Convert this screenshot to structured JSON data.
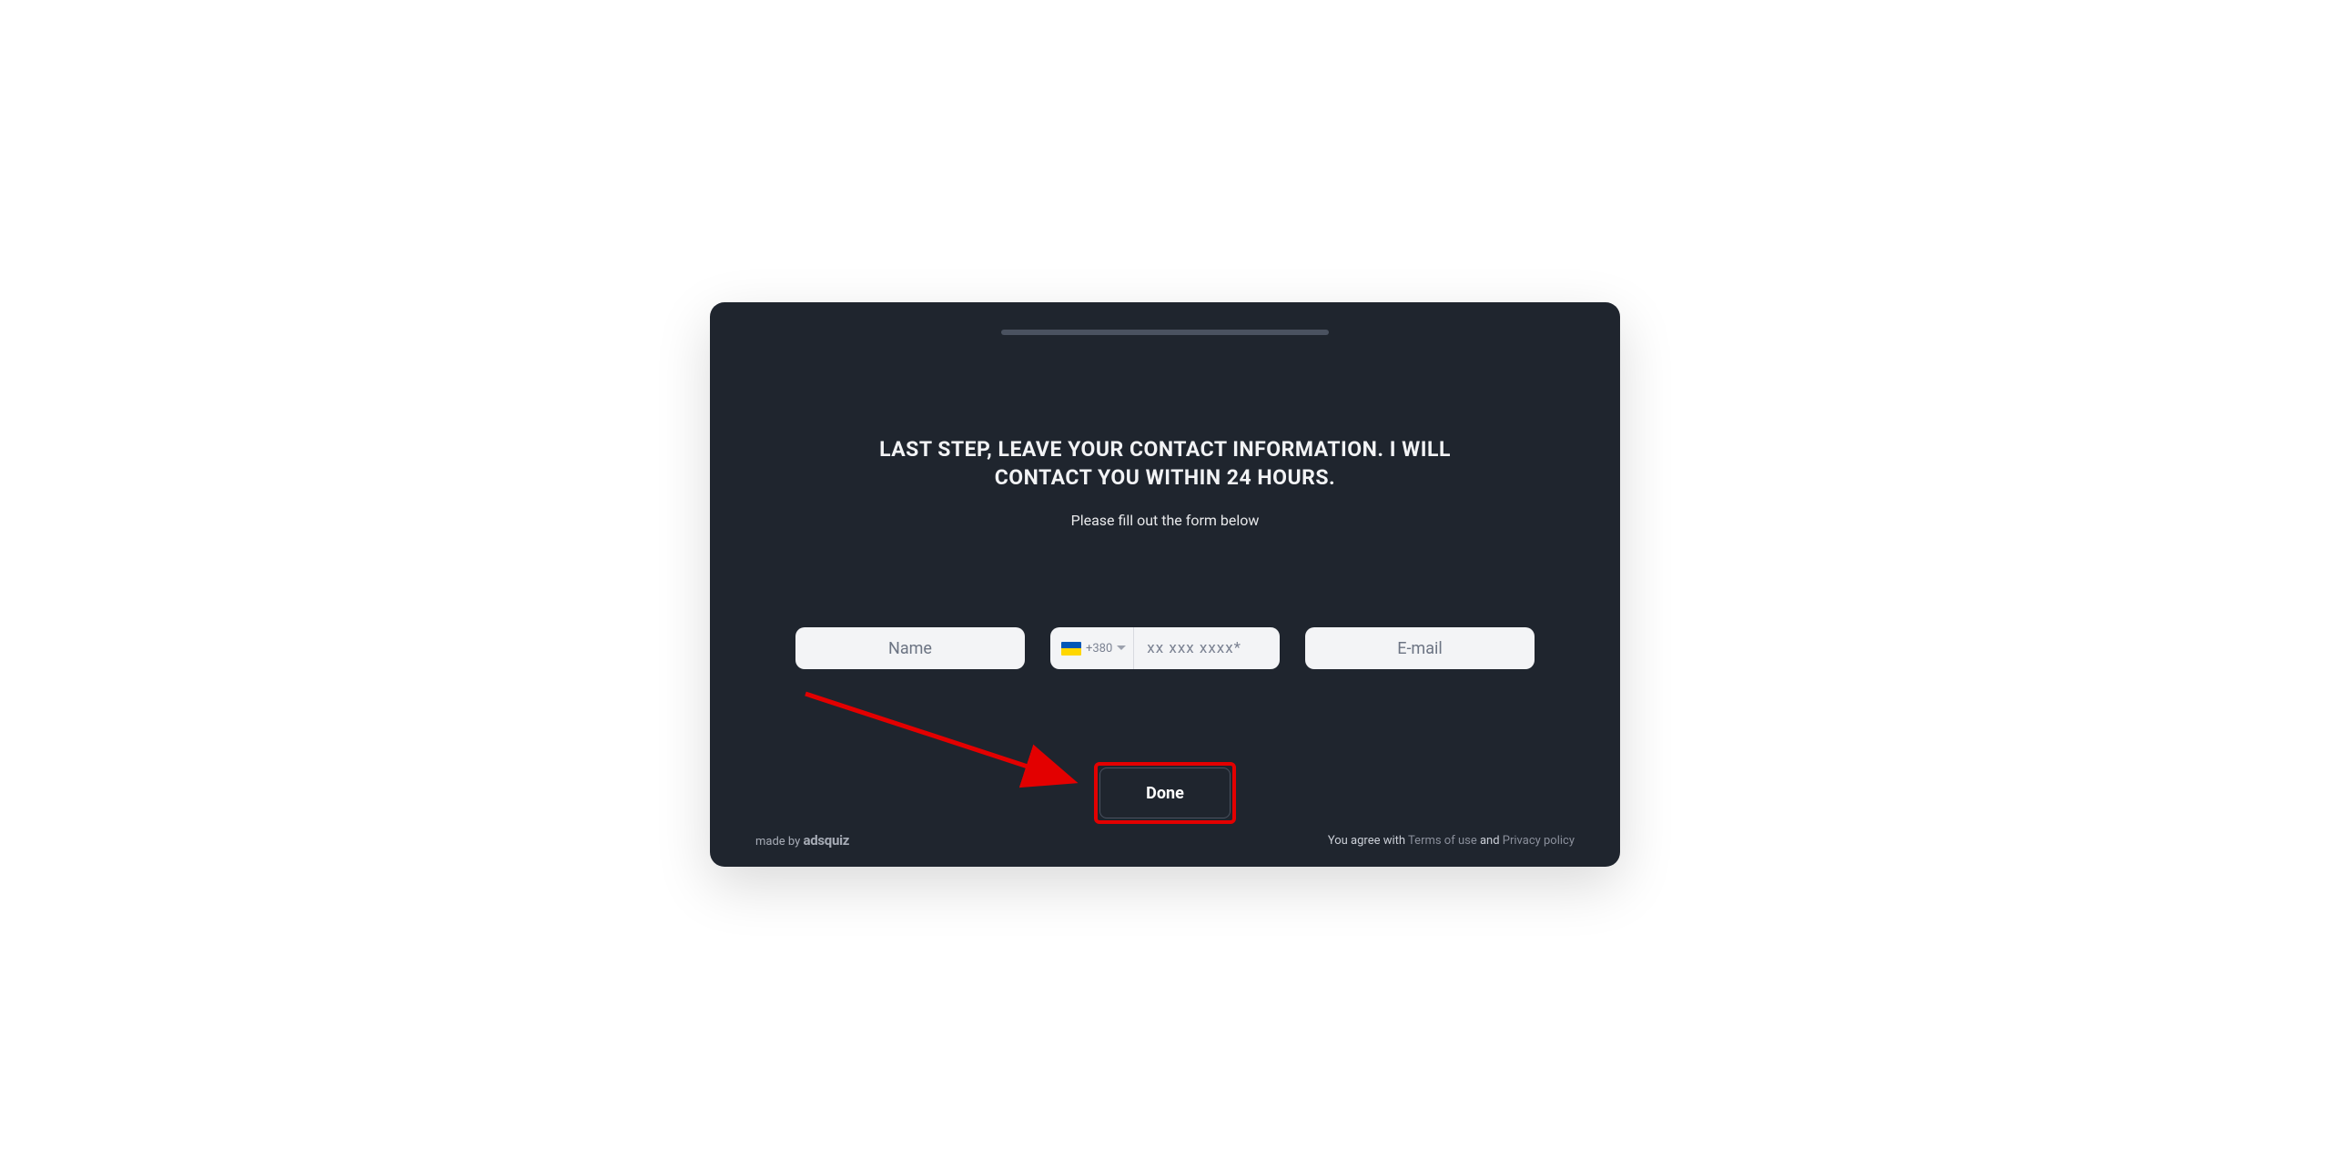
{
  "heading": "LAST STEP, LEAVE YOUR CONTACT INFORMATION. I WILL CONTACT YOU WITHIN 24 HOURS.",
  "subheading": "Please fill out the form below",
  "form": {
    "name_placeholder": "Name",
    "phone_country_code": "+380",
    "phone_placeholder": "xx xxx xxxx*",
    "email_placeholder": "E-mail"
  },
  "done_button_label": "Done",
  "footer": {
    "made_by_prefix": "made by ",
    "made_by_brand": "adsquiz",
    "agree_prefix": "You agree with ",
    "terms_label": "Terms of use",
    "and_text": " and ",
    "privacy_label": "Privacy policy"
  },
  "colors": {
    "background": "#1f252e",
    "highlight": "#e30000"
  }
}
